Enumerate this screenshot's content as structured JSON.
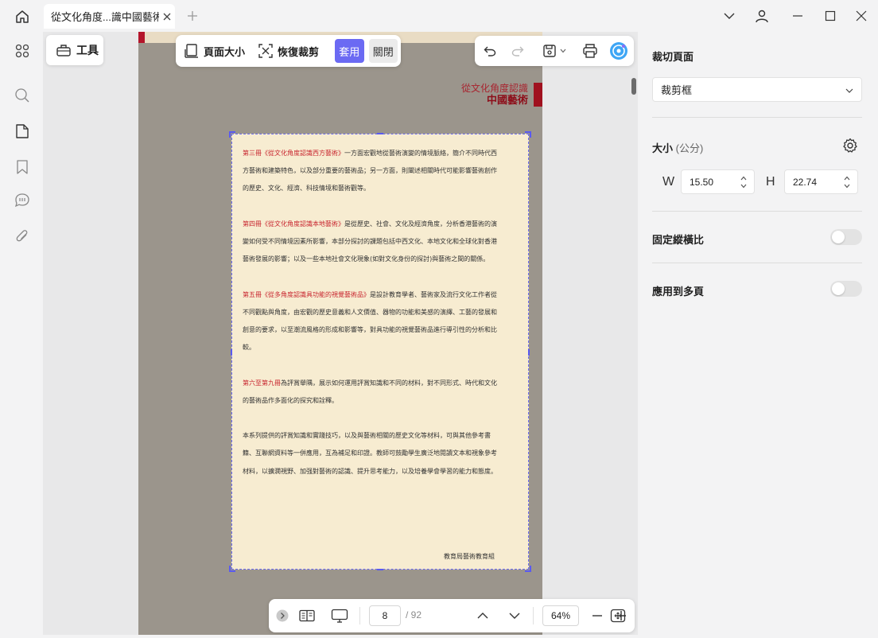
{
  "window": {
    "tab_title": "從文化角度...識中國藝術"
  },
  "toolbar": {
    "tools_label": "工具",
    "page_size_label": "頁面大小",
    "restore_crop_label": "恢復裁剪",
    "apply_label": "套用",
    "close_label": "關閉"
  },
  "document": {
    "header_line1": "從文化角度認識",
    "header_line2": "中國藝術",
    "paragraphs": [
      {
        "red": "第三冊《從文化角度認識西方藝術》",
        "text": "一方面宏觀地從藝術演變的情境脈絡，簡介不同時代西方藝術和建築特色，以及部分重要的藝術品；另一方面，則闡述相關時代可能影響藝術創作的歷史、文化、經濟、科技情境和藝術觀等。"
      },
      {
        "red": "第四冊《從文化角度認識本地藝術》",
        "text": "是從歷史、社會、文化及經濟角度，分析香港藝術的演變如何受不同情境因素所影響，本部分探討的課題包括中西文化、本地文化和全球化對香港藝術發展的影響；以及一些本地社會文化現象(如對文化身份的探討)與藝術之間的關係。"
      },
      {
        "red": "第五冊《從多角度認識具功能的視覺藝術品》",
        "text": "是設計教育學者、藝術家及流行文化工作者從不同觀點與角度，由宏觀的歷史意義和人文價值、器物的功能和美感的演繹、工藝的發展和創意的要求，以至潮流風格的形成和影響等，對具功能的視覺藝術品進行導引性的分析和比較。"
      },
      {
        "red": "第六至第九冊",
        "text": "為評賞舉隅，展示如何運用評賞知識和不同的材料，對不同形式、時代和文化的藝術品作多面化的探究和詮釋。"
      },
      {
        "red": "",
        "text": "本系列提供的評賞知識和實踐技巧，以及與藝術相關的歷史文化等材料，可與其他參考書籍、互聯網資料等一併應用，互為補足和印證。教師可鼓勵學生廣泛地閱讀文本和視象參考材料，以擴濶視野、加强對藝術的認識、提升思考能力，以及培養學會學習的能力和態度。"
      }
    ],
    "signature": "教育局藝術教育組"
  },
  "bottom_bar": {
    "current_page": "8",
    "total_pages": "/ 92",
    "zoom": "64%"
  },
  "right_panel": {
    "title": "裁切頁面",
    "crop_mode": "裁剪框",
    "size_label": "大小",
    "size_unit": "(公分)",
    "width_label": "W",
    "width_value": "15.50",
    "height_label": "H",
    "height_value": "22.74",
    "lock_ratio_label": "固定縱橫比",
    "lock_ratio_on": false,
    "apply_multi_label": "應用到多頁",
    "apply_multi_on": false
  },
  "colors": {
    "accent": "#6b6af3",
    "page_paper": "#f7ecd1",
    "red_text": "#c8262f"
  }
}
